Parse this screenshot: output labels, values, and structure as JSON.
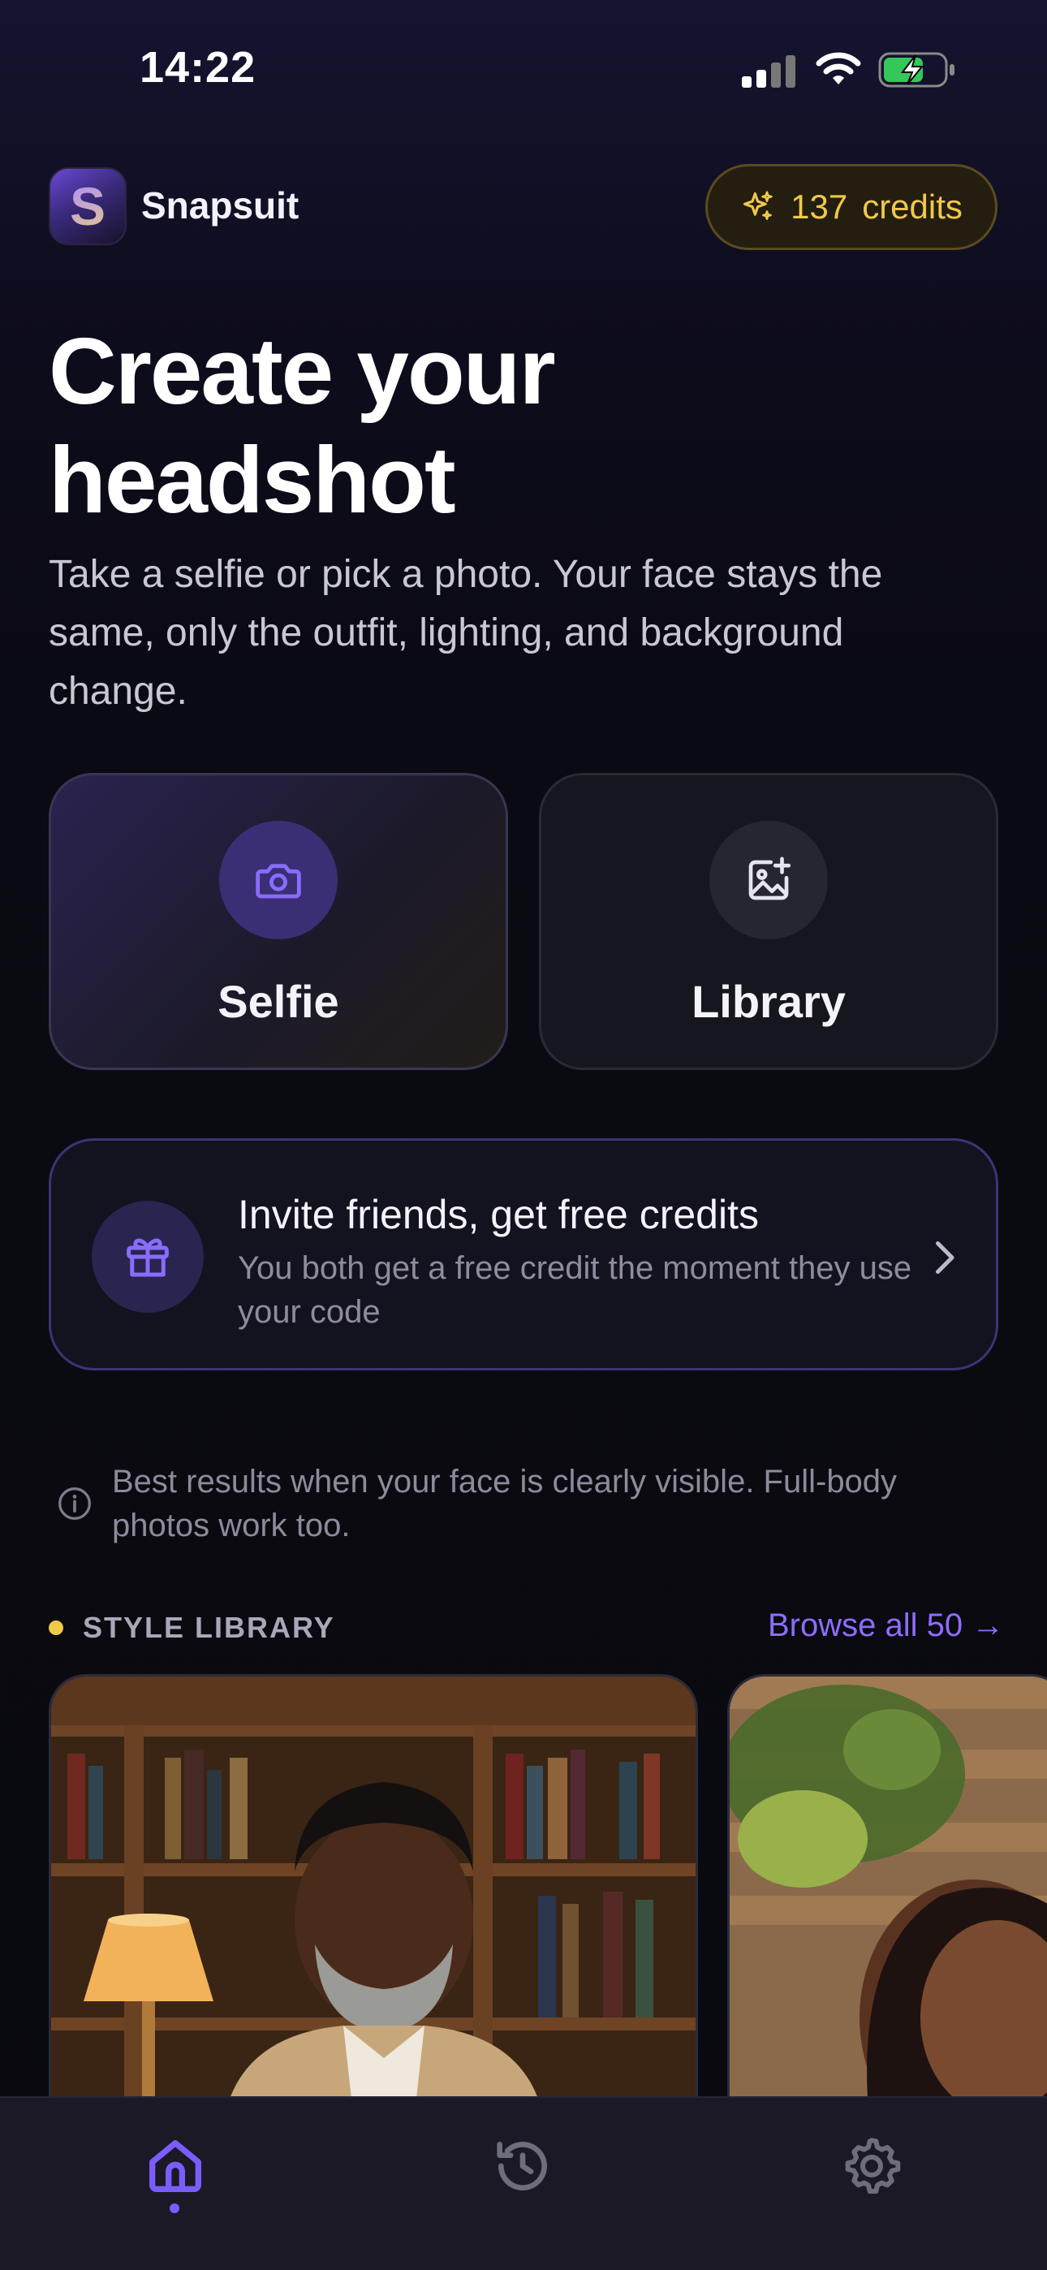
{
  "status_bar": {
    "time": "14:22"
  },
  "header": {
    "app_name": "Snapsuit",
    "logo_letter": "S",
    "credits_count": "137",
    "credits_label": "credits"
  },
  "hero": {
    "title_line1": "Create your",
    "title_line2": "headshot",
    "subtitle": "Take a selfie or pick a photo. Your face stays the same, only the outfit, lighting, and background change."
  },
  "actions": [
    {
      "label": "Selfie",
      "icon": "camera-icon"
    },
    {
      "label": "Library",
      "icon": "image-plus-icon"
    }
  ],
  "invite": {
    "title": "Invite friends, get free credits",
    "description": "You both get a free credit the moment they use your code",
    "icon": "gift-icon"
  },
  "tip": {
    "text": "Best results when your face is clearly visible. Full-body photos work too.",
    "icon": "info-icon"
  },
  "style_library": {
    "title": "STYLE LIBRARY",
    "browse_label": "Browse all 50 →",
    "items": [
      {
        "name": "style-card-library-office"
      },
      {
        "name": "style-card-plant-wall"
      }
    ]
  },
  "tabbar": {
    "items": [
      {
        "name": "home",
        "icon": "home-icon",
        "active": true
      },
      {
        "name": "history",
        "icon": "history-icon",
        "active": false
      },
      {
        "name": "settings",
        "icon": "gear-icon",
        "active": false
      }
    ]
  },
  "colors": {
    "accent": "#7b5cff",
    "gold": "#f1c94a",
    "background": "#0a0a12"
  }
}
